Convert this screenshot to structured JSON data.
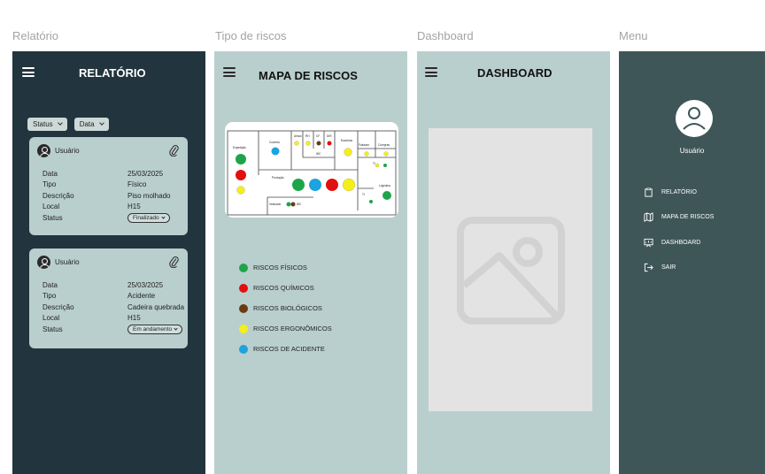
{
  "frame_titles": [
    "Relatório",
    "Tipo de riscos",
    "Dashboard",
    "Menu"
  ],
  "relatorio": {
    "header": "RELATÓRIO",
    "filters": [
      "Status",
      "Data"
    ],
    "cards": [
      {
        "user": "Usuário",
        "rows": [
          {
            "label": "Data",
            "value": "25/03/2025"
          },
          {
            "label": "Tipo",
            "value": "Físico"
          },
          {
            "label": "Descrição",
            "value": "Piso molhado"
          },
          {
            "label": "Local",
            "value": "H15"
          },
          {
            "label": "Status",
            "value": "Finalizado"
          }
        ]
      },
      {
        "user": "Usuário",
        "rows": [
          {
            "label": "Data",
            "value": "25/03/2025"
          },
          {
            "label": "Tipo",
            "value": "Acidente"
          },
          {
            "label": "Descrição",
            "value": "Cadeira quebrada"
          },
          {
            "label": "Local",
            "value": "H15"
          },
          {
            "label": "Status",
            "value": "Em andamento"
          }
        ]
      }
    ]
  },
  "mapa": {
    "header": "MAPA DE RISCOS",
    "map_labels": {
      "expedicao": "Expedição",
      "cozinha": "Cozinha",
      "producao": "Produção",
      "logistica": "Logística",
      "vestuario": "Vestuário",
      "wc1": "WC",
      "wc2": "WC",
      "escritorio": "Escritório",
      "almox": "Almox",
      "ti": "TI",
      "rh": "RH",
      "cf": "CF",
      "dir": "DIR",
      "fat": "Faturam",
      "compras": "Compras",
      "ti2": "TI",
      "ti3": "TI"
    },
    "legend": [
      {
        "label": "RISCOS FÍSICOS",
        "color": "#1ea44a"
      },
      {
        "label": "RISCOS QUÍMICOS",
        "color": "#e01010"
      },
      {
        "label": "RISCOS BIOLÓGICOS",
        "color": "#6b3a12"
      },
      {
        "label": "RISCOS ERGONÔMICOS",
        "color": "#f4ef1a"
      },
      {
        "label": "RISCOS DE ACIDENTE",
        "color": "#1ca3e0"
      }
    ]
  },
  "dashboard": {
    "header": "DASHBOARD"
  },
  "menu": {
    "user": "Usuário",
    "items": [
      "RELATÓRIO",
      "MAPA DE RISCOS",
      "DASHBOARD",
      "SAIR"
    ]
  }
}
